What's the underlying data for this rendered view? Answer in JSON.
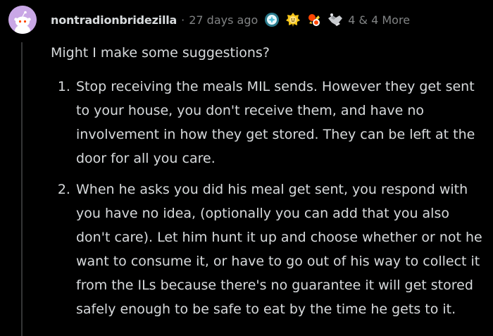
{
  "comment": {
    "username": "nontradionbridezilla",
    "separator": "·",
    "timestamp": "27 days ago",
    "awards": [
      {
        "icon": "helpful-award-icon",
        "color": "#4fbcd4"
      },
      {
        "icon": "wholesome-award-icon",
        "color": "#f5c518"
      },
      {
        "icon": "take-my-energy-award-icon",
        "color": "#ff4500"
      },
      {
        "icon": "handshake-award-icon",
        "color": "#b0b3b8"
      }
    ],
    "awards_more": "4 & 4 More",
    "intro": "Might I make some suggestions?",
    "items": [
      "Stop receiving the meals MIL sends. However they get sent to your house, you don't receive them, and have no involvement in how they get stored. They can be left at the door for all you care.",
      "When he asks you did his meal get sent, you respond with you have no idea, (optionally you can add that you also don't care). Let him hunt it up and choose whether or not he want to consume it, or have to go out of his way to collect it from the ILs because there's no guarantee it will get stored safely enough to be safe to eat by the time he gets to it."
    ]
  },
  "colors": {
    "background": "#000000",
    "text": "#d7dadc",
    "meta": "#818384",
    "avatar_bg": "#c9a7e6",
    "thread_line": "#343536"
  }
}
